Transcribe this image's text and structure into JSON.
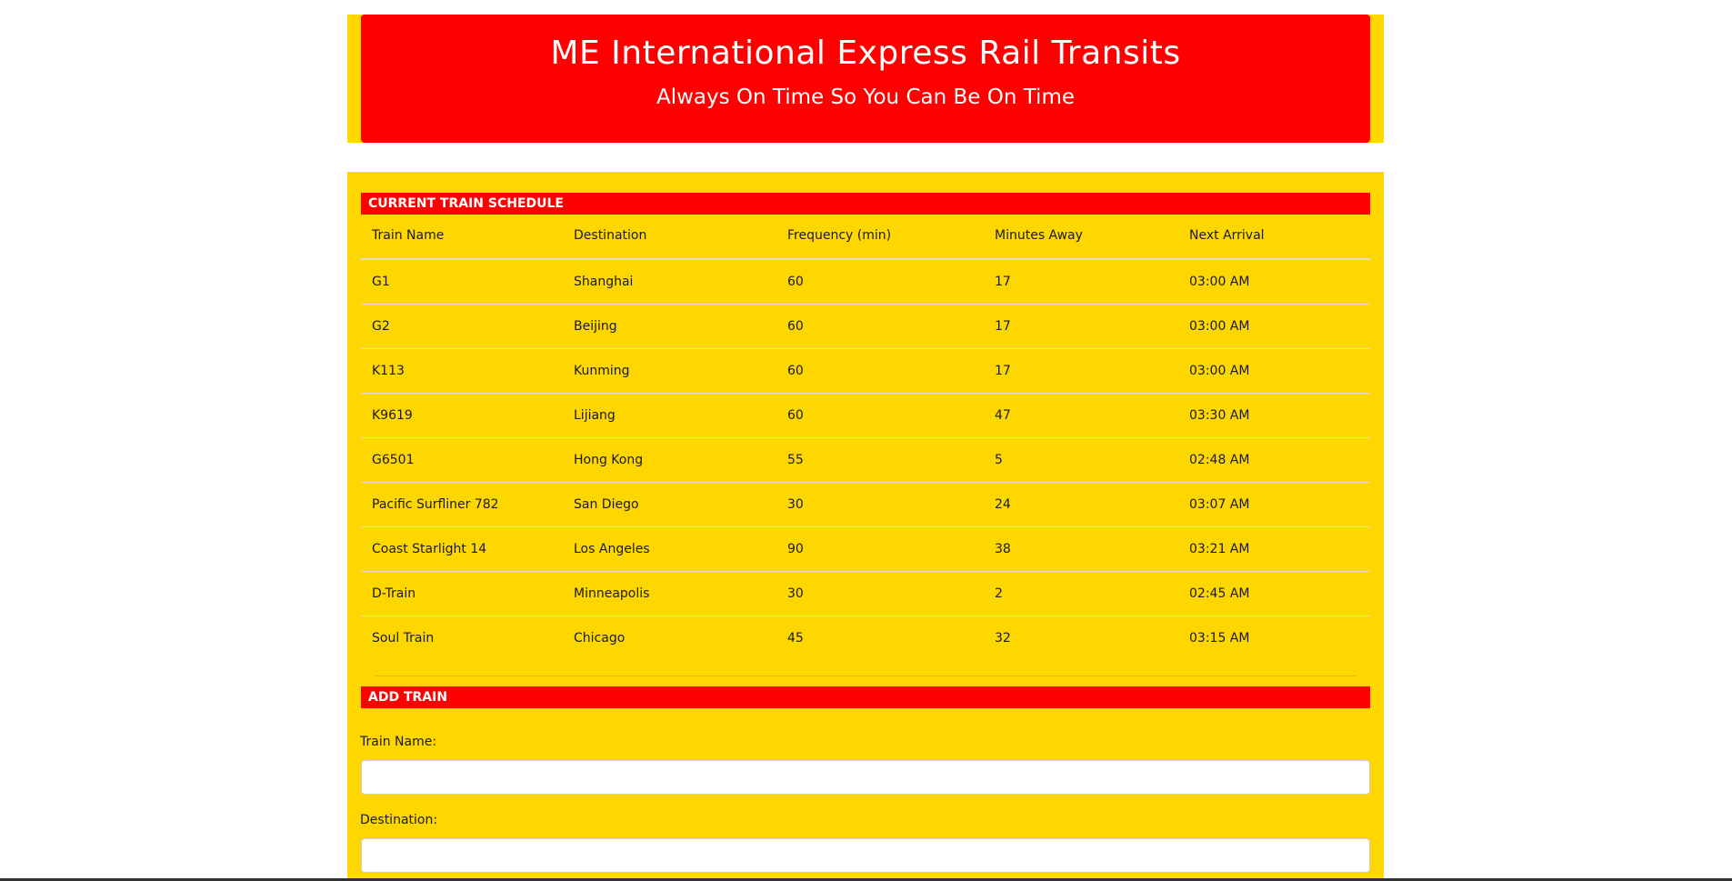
{
  "header": {
    "title": "ME International Express Rail Transits",
    "tagline": "Always On Time So You Can Be On Time"
  },
  "schedule": {
    "heading": "CURRENT TRAIN SCHEDULE",
    "columns": [
      "Train Name",
      "Destination",
      "Frequency (min)",
      "Minutes Away",
      "Next Arrival"
    ],
    "rows": [
      [
        "G1",
        "Shanghai",
        "60",
        "17",
        "03:00 AM"
      ],
      [
        "G2",
        "Beijing",
        "60",
        "17",
        "03:00 AM"
      ],
      [
        "K113",
        "Kunming",
        "60",
        "17",
        "03:00 AM"
      ],
      [
        "K9619",
        "Lijiang",
        "60",
        "47",
        "03:30 AM"
      ],
      [
        "G6501",
        "Hong Kong",
        "55",
        "5",
        "02:48 AM"
      ],
      [
        "Pacific Surfliner 782",
        "San Diego",
        "30",
        "24",
        "03:07 AM"
      ],
      [
        "Coast Starlight 14",
        "Los Angeles",
        "90",
        "38",
        "03:21 AM"
      ],
      [
        "D-Train",
        "Minneapolis",
        "30",
        "2",
        "02:45 AM"
      ],
      [
        "Soul Train",
        "Chicago",
        "45",
        "32",
        "03:15 AM"
      ]
    ]
  },
  "add_train": {
    "heading": "ADD TRAIN",
    "train_name_label": "Train Name:",
    "train_name_value": "",
    "destination_label": "Destination:",
    "destination_value": ""
  },
  "colors": {
    "header_bg": "#ff0000",
    "page_accent": "#ffd700",
    "header_text": "#ffffff"
  }
}
